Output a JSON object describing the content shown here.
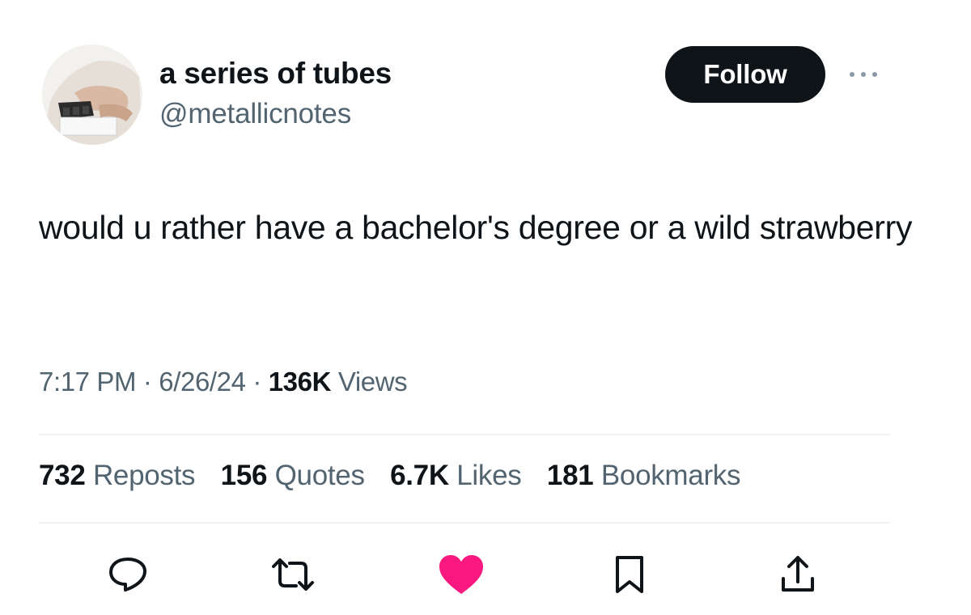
{
  "author": {
    "display_name": "a series of tubes",
    "handle": "@metallicnotes"
  },
  "header": {
    "follow_label": "Follow",
    "more_icon": "more-horizontal-icon"
  },
  "tweet": {
    "text": "would u rather have a bachelor's degree or a wild strawberry",
    "time": "7:17 PM",
    "separator": "·",
    "date": "6/26/24",
    "views_count": "136K",
    "views_label": "Views"
  },
  "stats": {
    "reposts": {
      "count": "732",
      "label": "Reposts"
    },
    "quotes": {
      "count": "156",
      "label": "Quotes"
    },
    "likes": {
      "count": "6.7K",
      "label": "Likes"
    },
    "bookmarks": {
      "count": "181",
      "label": "Bookmarks"
    }
  },
  "actions": [
    {
      "icon": "reply-icon"
    },
    {
      "icon": "repost-icon"
    },
    {
      "icon": "like-icon",
      "liked": true
    },
    {
      "icon": "bookmark-icon"
    },
    {
      "icon": "share-icon"
    }
  ],
  "colors": {
    "text_primary": "#0f1419",
    "text_secondary": "#536471",
    "follow_button_bg": "#0f1419",
    "like_active": "#f91880",
    "divider": "#eff3f4"
  }
}
